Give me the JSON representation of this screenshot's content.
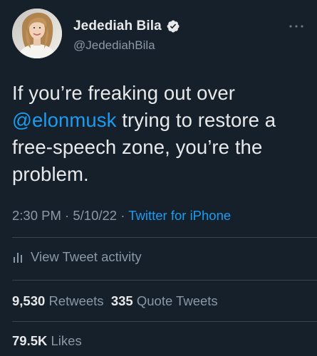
{
  "author": {
    "display_name": "Jedediah Bila",
    "handle": "@JedediahBila",
    "verified": true
  },
  "tweet": {
    "text_before": "If you’re freaking out over ",
    "mention": "@elonmusk",
    "text_after": " trying to restore a free-speech zone, you’re the problem.",
    "time": "2:30 PM",
    "date": "5/10/22",
    "source": "Twitter for iPhone",
    "separator": "·"
  },
  "activity": {
    "label": "View Tweet activity"
  },
  "stats": {
    "retweets_count": "9,530",
    "retweets_label": "Retweets",
    "quotes_count": "335",
    "quotes_label": "Quote Tweets",
    "likes_count": "79.5K",
    "likes_label": "Likes"
  },
  "colors": {
    "background": "#15202b",
    "text": "#e7e9ea",
    "secondary": "#8b98a5",
    "accent": "#1d9bf0",
    "divider": "#38444d"
  },
  "icons": {
    "verified": "verified-badge-icon",
    "more": "more-options-icon",
    "activity": "activity-bars-icon"
  }
}
